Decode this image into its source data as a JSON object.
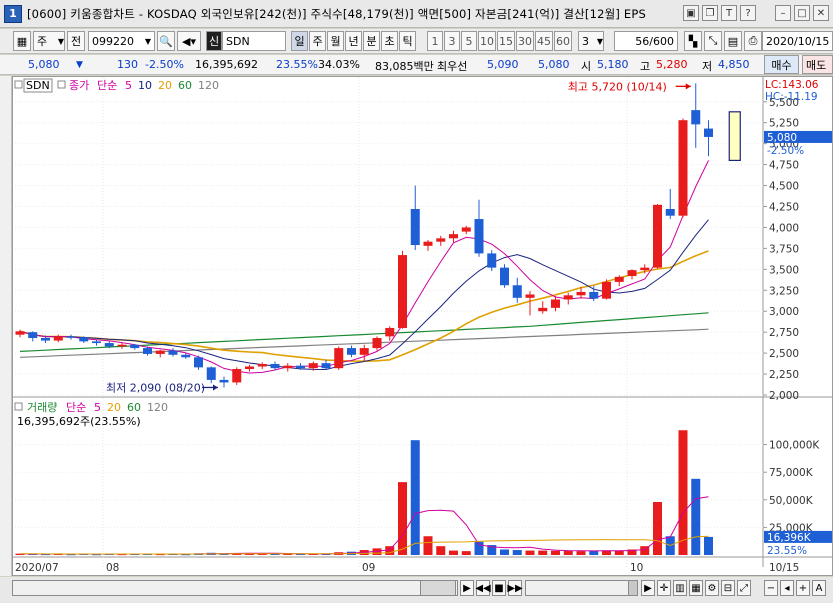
{
  "window": {
    "num": "1",
    "title": "[0600] 키움종합차트 - KOSDAQ 외국인보유[242(천)] 주식수[48,179(천)] 액면[500] 자본금[241(억)] 결산[12월] EPS"
  },
  "toolbar": {
    "mode": "주",
    "scope": "전",
    "code": "099220",
    "sin": "신",
    "name": "SDN",
    "periods": [
      "일",
      "주",
      "월",
      "년",
      "분",
      "초",
      "틱"
    ],
    "minutes": [
      "1",
      "3",
      "5",
      "10",
      "15",
      "30",
      "45",
      "60"
    ],
    "tick_value": "3",
    "count": "56/600",
    "date": "2020/10/15"
  },
  "quote": {
    "price": "5,080",
    "change": "130",
    "change_pct": "-2.50%",
    "volume": "16,395,692",
    "vol_pct": "23.55%",
    "turnover": "34.03%",
    "amount": "83,085백만",
    "best_label": "최우선",
    "best_sell": "5,090",
    "best_buy": "5,080",
    "open_label": "시",
    "open": "5,180",
    "high_label": "고",
    "high": "5,280",
    "low_label": "저",
    "low": "4,850",
    "buy_button": "매수",
    "sell_button": "매도"
  },
  "chart_data": [
    {
      "type": "candlestick",
      "title": "SDN",
      "legend": [
        "종가",
        "단순",
        "5",
        "10",
        "20",
        "60",
        "120"
      ],
      "ylim": [
        2000,
        5700
      ],
      "yticks": [
        "5,500",
        "5,250",
        "5,000",
        "4,750",
        "4,500",
        "4,250",
        "4,000",
        "3,750",
        "3,500",
        "3,250",
        "3,000",
        "2,750",
        "2,500",
        "2,250",
        "2,000"
      ],
      "ma_colors": {
        "5": "#d000a0",
        "10": "#1a237e",
        "20": "#e0a000",
        "60": "#1a8a30",
        "120": "#808080"
      },
      "lc": "LC:143.06",
      "hc": "HC:-11.19",
      "last_price": "5,080",
      "last_change": "-2.50%",
      "annotations": {
        "high": "최고 5,720 (10/14)",
        "low": "최저 2,090 (08/20)"
      },
      "x_labels": [
        "2020/07",
        "08",
        "09",
        "10",
        "10/15"
      ],
      "candles": [
        [
          2720,
          2780,
          2690,
          2760
        ],
        [
          2750,
          2760,
          2640,
          2680
        ],
        [
          2680,
          2710,
          2620,
          2650
        ],
        [
          2650,
          2720,
          2630,
          2700
        ],
        [
          2700,
          2720,
          2660,
          2690
        ],
        [
          2690,
          2700,
          2620,
          2640
        ],
        [
          2640,
          2660,
          2590,
          2620
        ],
        [
          2620,
          2640,
          2560,
          2580
        ],
        [
          2580,
          2620,
          2550,
          2600
        ],
        [
          2600,
          2610,
          2540,
          2560
        ],
        [
          2560,
          2580,
          2470,
          2490
        ],
        [
          2490,
          2540,
          2450,
          2530
        ],
        [
          2530,
          2560,
          2460,
          2480
        ],
        [
          2480,
          2500,
          2430,
          2450
        ],
        [
          2450,
          2470,
          2300,
          2330
        ],
        [
          2330,
          2340,
          2140,
          2180
        ],
        [
          2180,
          2220,
          2090,
          2150
        ],
        [
          2150,
          2330,
          2120,
          2310
        ],
        [
          2310,
          2360,
          2280,
          2340
        ],
        [
          2340,
          2390,
          2310,
          2370
        ],
        [
          2370,
          2400,
          2300,
          2320
        ],
        [
          2320,
          2380,
          2280,
          2350
        ],
        [
          2350,
          2380,
          2300,
          2320
        ],
        [
          2320,
          2400,
          2290,
          2380
        ],
        [
          2380,
          2420,
          2300,
          2320
        ],
        [
          2320,
          2580,
          2300,
          2560
        ],
        [
          2560,
          2590,
          2450,
          2480
        ],
        [
          2480,
          2600,
          2400,
          2560
        ],
        [
          2560,
          2700,
          2530,
          2680
        ],
        [
          2700,
          2820,
          2650,
          2800
        ],
        [
          2800,
          3720,
          2790,
          3670
        ],
        [
          4220,
          4500,
          3730,
          3790
        ],
        [
          3780,
          3850,
          3720,
          3830
        ],
        [
          3830,
          3900,
          3780,
          3870
        ],
        [
          3870,
          3960,
          3820,
          3920
        ],
        [
          3950,
          4020,
          3920,
          4000
        ],
        [
          4100,
          4330,
          3650,
          3690
        ],
        [
          3690,
          3730,
          3480,
          3520
        ],
        [
          3520,
          3560,
          3280,
          3310
        ],
        [
          3310,
          3400,
          3100,
          3160
        ],
        [
          3160,
          3240,
          2950,
          3200
        ],
        [
          3000,
          3120,
          2970,
          3040
        ],
        [
          3040,
          3180,
          3000,
          3140
        ],
        [
          3140,
          3220,
          3080,
          3190
        ],
        [
          3190,
          3290,
          3150,
          3230
        ],
        [
          3230,
          3300,
          3120,
          3150
        ],
        [
          3150,
          3380,
          3140,
          3350
        ],
        [
          3350,
          3430,
          3300,
          3410
        ],
        [
          3420,
          3500,
          3380,
          3490
        ],
        [
          3490,
          3560,
          3450,
          3520
        ],
        [
          3520,
          4280,
          3510,
          4270
        ],
        [
          4220,
          4460,
          4100,
          4140
        ],
        [
          4140,
          5300,
          4120,
          5280
        ],
        [
          5400,
          5720,
          4950,
          5230
        ],
        [
          5180,
          5280,
          4850,
          5080
        ]
      ]
    },
    {
      "type": "bar",
      "title": "거래량",
      "legend": [
        "거래량",
        "단순",
        "5",
        "20",
        "60",
        "120"
      ],
      "ylim": [
        0,
        125000
      ],
      "yticks": [
        "100,000K",
        "75,000K",
        "50,000K",
        "25,000K"
      ],
      "last_volume": "16,396K",
      "last_pct": "23.55%",
      "volume_caption": "16,395,692주(23.55%)",
      "values": [
        1200,
        900,
        800,
        1000,
        700,
        900,
        700,
        1100,
        800,
        900,
        1000,
        800,
        900,
        700,
        1500,
        2000,
        1200,
        1800,
        1400,
        1200,
        1000,
        1100,
        900,
        1000,
        1100,
        2500,
        3000,
        4500,
        6000,
        8000,
        66000,
        104000,
        17000,
        8000,
        4000,
        3500,
        12000,
        9000,
        5000,
        4500,
        4000,
        4000,
        3800,
        3600,
        3500,
        3800,
        4200,
        3900,
        5000,
        8000,
        48000,
        17000,
        113000,
        69000,
        16396
      ],
      "ma5": [
        1000,
        950,
        920,
        900,
        860,
        880,
        820,
        880,
        840,
        880,
        880,
        900,
        860,
        860,
        980,
        1180,
        1260,
        1440,
        1580,
        1620,
        1520,
        1340,
        1120,
        1040,
        1020,
        1320,
        1720,
        2420,
        3420,
        4800,
        17500,
        37600,
        40200,
        40600,
        39800,
        27300,
        9300,
        7300,
        6700,
        6600,
        7000,
        5300,
        4460,
        4000,
        3780,
        3740,
        3760,
        3800,
        4080,
        4980,
        13800,
        16400,
        38200,
        51000,
        52700
      ],
      "colors": {
        "up": "#e81c1c",
        "down": "#1f5fd6"
      }
    }
  ]
}
